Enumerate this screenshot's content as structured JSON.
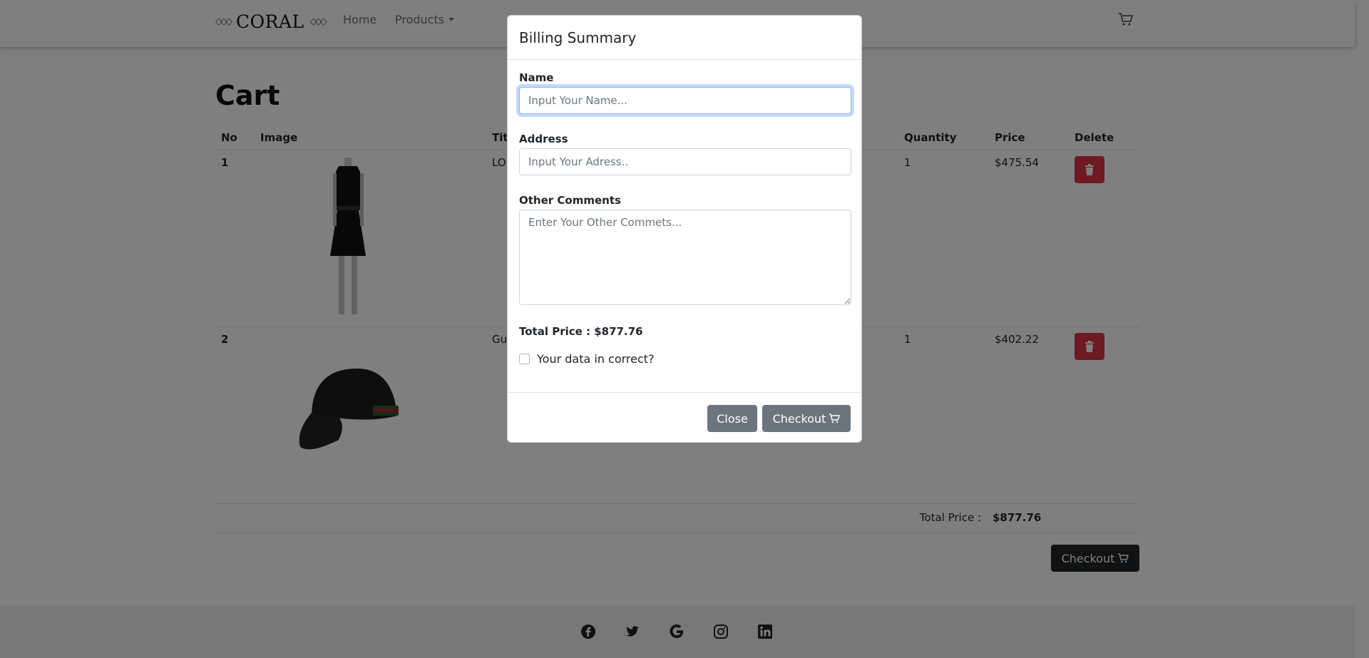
{
  "navbar": {
    "brand": "CORAL",
    "home_label": "Home",
    "products_label": "Products"
  },
  "cart": {
    "title": "Cart",
    "columns": [
      "No",
      "Image",
      "Title",
      "Quantity",
      "Price",
      "Delete"
    ],
    "rows": [
      {
        "no": "1",
        "title": "LO",
        "quantity": "1",
        "price": "$475.54"
      },
      {
        "no": "2",
        "title": "Gu",
        "quantity": "1",
        "price": "$402.22"
      }
    ],
    "total_label": "Total Price :",
    "total_value": "$877.76",
    "checkout_label": "Checkout"
  },
  "modal": {
    "title": "Billing Summary",
    "name_label": "Name",
    "name_placeholder": "Input Your Name...",
    "address_label": "Address",
    "address_placeholder": "Input Your Adress..",
    "comments_label": "Other Comments",
    "comments_placeholder": "Enter Your Other Commets...",
    "total_price": "Total Price : $877.76",
    "confirm_label": "Your data in correct?",
    "close_label": "Close",
    "checkout_label": "Checkout"
  },
  "colors": {
    "danger": "#dc3545",
    "secondary": "#6c757d",
    "dark": "#212529"
  },
  "footer": {
    "icons": [
      "facebook-icon",
      "twitter-icon",
      "google-icon",
      "instagram-icon",
      "linkedin-icon"
    ]
  }
}
